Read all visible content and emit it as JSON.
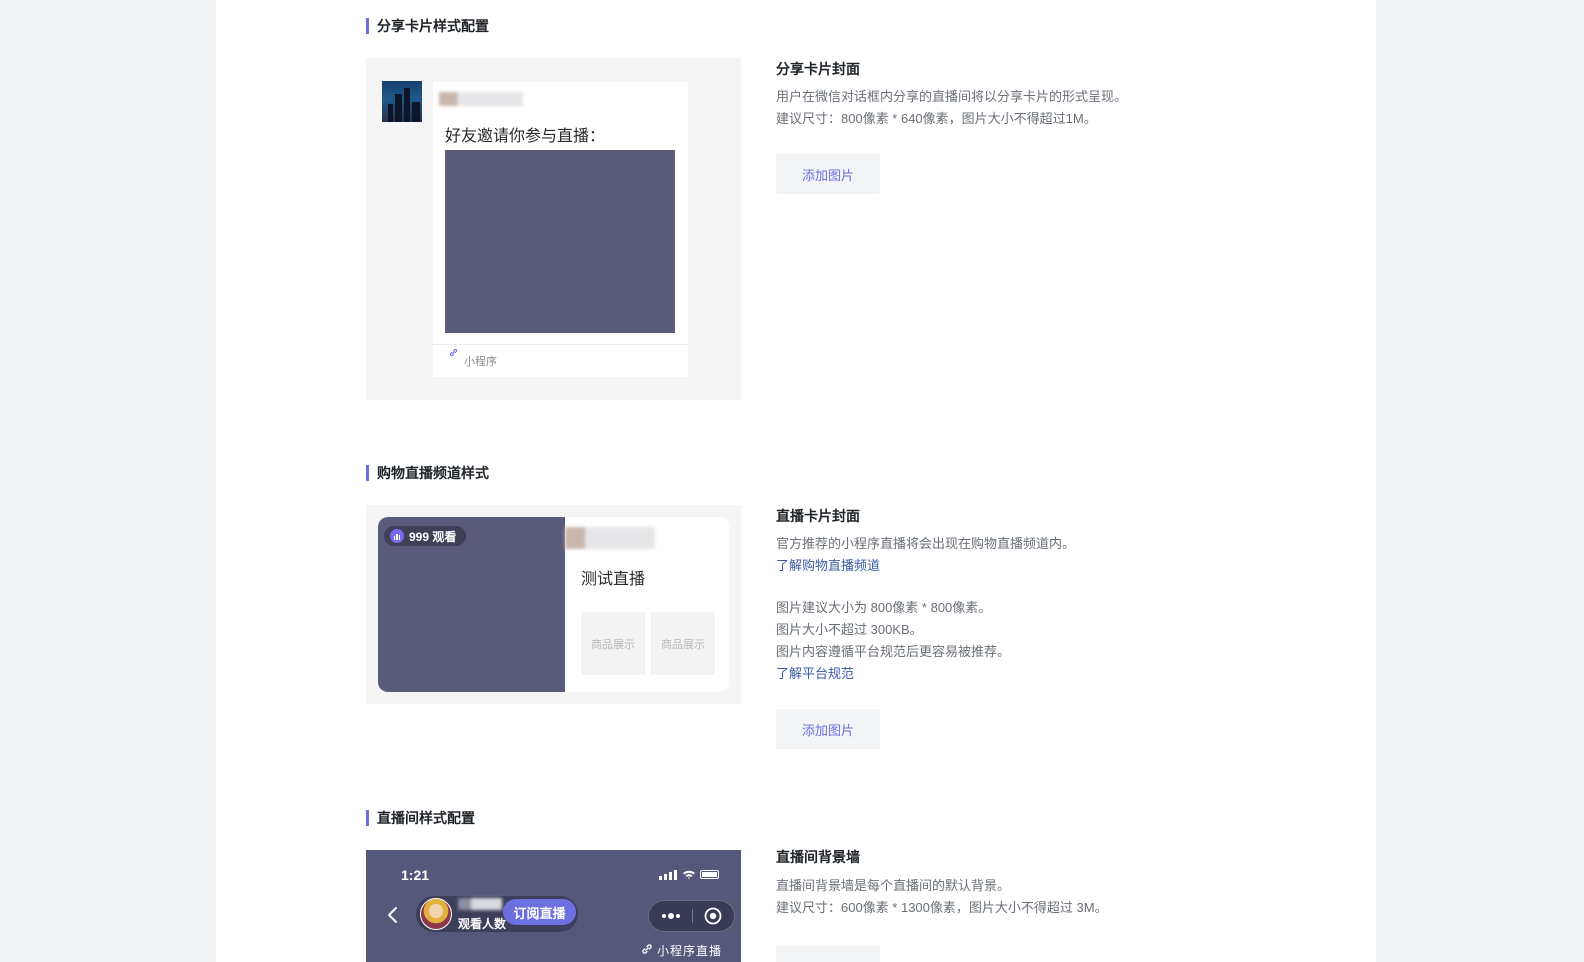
{
  "sections": {
    "share_card": {
      "title": "分享卡片样式配置",
      "preview": {
        "invite_text": "好友邀请你参与直播：",
        "mini_program_label": "小程序"
      },
      "info": {
        "title": "分享卡片封面",
        "desc": "用户在微信对话框内分享的直播间将以分享卡片的形式呈现。",
        "size_hint": "建议尺寸：800像素 * 640像素，图片大小不得超过1M。"
      },
      "add_button": "添加图片"
    },
    "channel": {
      "title": "购物直播频道样式",
      "preview": {
        "viewer_badge": "999 观看",
        "live_title": "测试直播",
        "goods": [
          "商品展示",
          "商品展示"
        ]
      },
      "info": {
        "title": "直播卡片封面",
        "desc": "官方推荐的小程序直播将会出现在购物直播频道内。",
        "link_channel": "了解购物直播频道",
        "hint1": "图片建议大小为 800像素 * 800像素。",
        "hint2": "图片大小不超过 300KB。",
        "hint3": "图片内容遵循平台规范后更容易被推荐。",
        "link_rules": "了解平台规范"
      },
      "add_button": "添加图片"
    },
    "room": {
      "title": "直播间样式配置",
      "preview": {
        "time": "1:21",
        "viewers_label": "观看人数",
        "subscribe_button": "订阅直播",
        "mini_live_label": "小程序直播"
      },
      "info": {
        "title": "直播间背景墙",
        "desc": "直播间背景墙是每个直播间的默认背景。",
        "size_hint": "建议尺寸：600像素 * 1300像素，图片大小不得超过 3M。"
      }
    }
  },
  "colors": {
    "accent": "#6b6fe0",
    "link": "#3a5ba8",
    "cover": "#5b5b7b"
  },
  "icons": [
    "link-icon",
    "signal-icon",
    "wifi-icon",
    "battery-icon",
    "back-chevron-icon",
    "more-icon",
    "record-icon",
    "live-bars-icon"
  ]
}
